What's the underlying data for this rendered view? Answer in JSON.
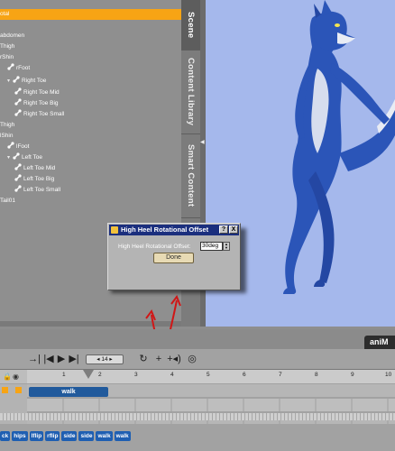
{
  "scene_tree": {
    "selected_label": "otal",
    "items": [
      {
        "label": "Thigh",
        "indent": 0,
        "icon": "",
        "expander": ""
      },
      {
        "label": "rShin",
        "indent": 0,
        "icon": "",
        "expander": ""
      },
      {
        "label": "rFoot",
        "indent": 1,
        "icon": "bone-icon",
        "expander": ""
      },
      {
        "label": "Right Toe",
        "indent": 1,
        "icon": "bone-icon",
        "expander": "▾"
      },
      {
        "label": "Right Toe Mid",
        "indent": 2,
        "icon": "bone-icon",
        "expander": ""
      },
      {
        "label": "Right Toe Big",
        "indent": 2,
        "icon": "bone-icon",
        "expander": ""
      },
      {
        "label": "Right Toe Small",
        "indent": 2,
        "icon": "bone-icon",
        "expander": ""
      },
      {
        "label": "Thigh",
        "indent": 0,
        "icon": "",
        "expander": ""
      },
      {
        "label": "lShin",
        "indent": 0,
        "icon": "",
        "expander": ""
      },
      {
        "label": "lFoot",
        "indent": 1,
        "icon": "bone-icon",
        "expander": ""
      },
      {
        "label": "Left Toe",
        "indent": 1,
        "icon": "bone-icon",
        "expander": "▾"
      },
      {
        "label": "Left Toe Mid",
        "indent": 2,
        "icon": "bone-icon",
        "expander": ""
      },
      {
        "label": "Left Toe Big",
        "indent": 2,
        "icon": "bone-icon",
        "expander": ""
      },
      {
        "label": "Left Toe Small",
        "indent": 2,
        "icon": "bone-icon",
        "expander": ""
      },
      {
        "label": "Tail01",
        "indent": 0,
        "icon": "",
        "expander": ""
      }
    ],
    "abdomen_label": "abdomen"
  },
  "tabs": [
    {
      "label": "Scene",
      "active": true
    },
    {
      "label": "Content Library",
      "active": false
    },
    {
      "label": "Smart Content",
      "active": false
    }
  ],
  "dialog": {
    "title": "High Heel Rotational Offset",
    "help_button": "?",
    "close_button": "X",
    "field_label": "High Heel Rotational Offset:",
    "field_value": "30deg",
    "done_label": "Done"
  },
  "timeline": {
    "tab_label": "aniM",
    "current_frame": "14",
    "ruler_numbers": [
      "1",
      "2",
      "3",
      "4",
      "5",
      "6",
      "7",
      "8",
      "9",
      "10"
    ],
    "walk_block_label": "walk",
    "chips": [
      "ck",
      "hips",
      "lflip",
      "rflip",
      "side",
      "side",
      "walk",
      "walk"
    ]
  },
  "colors": {
    "selection": "#f7a414",
    "dialog_title_bar": "#1b2f7e",
    "viewport_bg": "#a5b8ec",
    "figure_blue": "#2b55b8",
    "figure_white": "#e9ecf4",
    "walk_block": "#215a9c",
    "annotation_red": "#d01717"
  }
}
